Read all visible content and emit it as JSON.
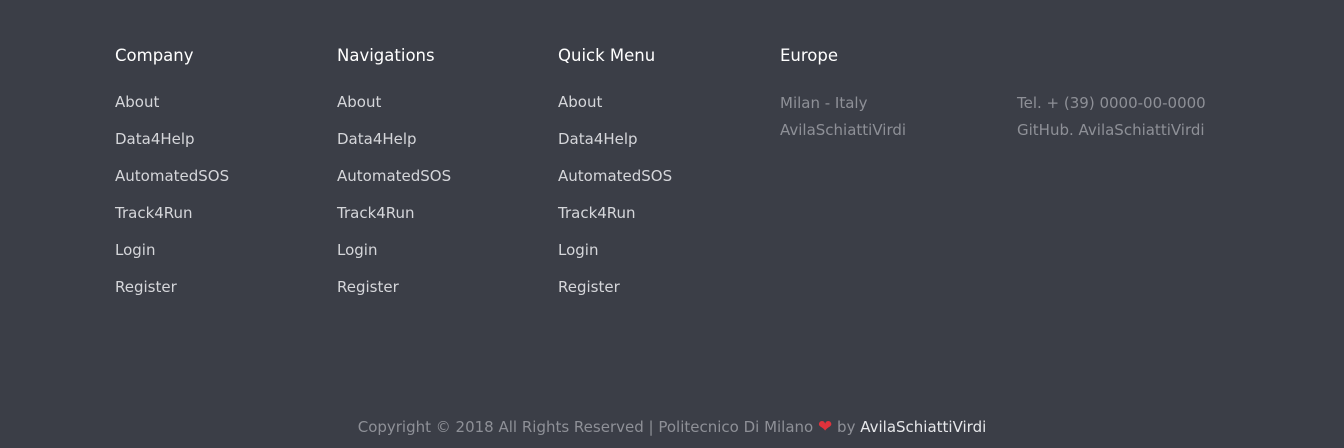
{
  "columns": [
    {
      "title": "Company",
      "links": [
        "About",
        "Data4Help",
        "AutomatedSOS",
        "Track4Run",
        "Login",
        "Register"
      ]
    },
    {
      "title": "Navigations",
      "links": [
        "About",
        "Data4Help",
        "AutomatedSOS",
        "Track4Run",
        "Login",
        "Register"
      ]
    },
    {
      "title": "Quick Menu",
      "links": [
        "About",
        "Data4Help",
        "AutomatedSOS",
        "Track4Run",
        "Login",
        "Register"
      ]
    }
  ],
  "europe": {
    "title": "Europe",
    "left": [
      "Milan - Italy",
      "AvilaSchiattiVirdi"
    ],
    "right": [
      "Tel. + (39) 0000-00-0000",
      "GitHub. AvilaSchiattiVirdi"
    ]
  },
  "copyright": {
    "text": "Copyright © 2018 All Rights Reserved | Politecnico Di Milano",
    "heart": "❤",
    "by": "by",
    "author": "AvilaSchiattiVirdi"
  },
  "colors": {
    "background": "#3b3e47",
    "heading": "#ffffff",
    "link": "#d5d6da",
    "muted": "#8e9097",
    "heart": "#e0323c"
  }
}
